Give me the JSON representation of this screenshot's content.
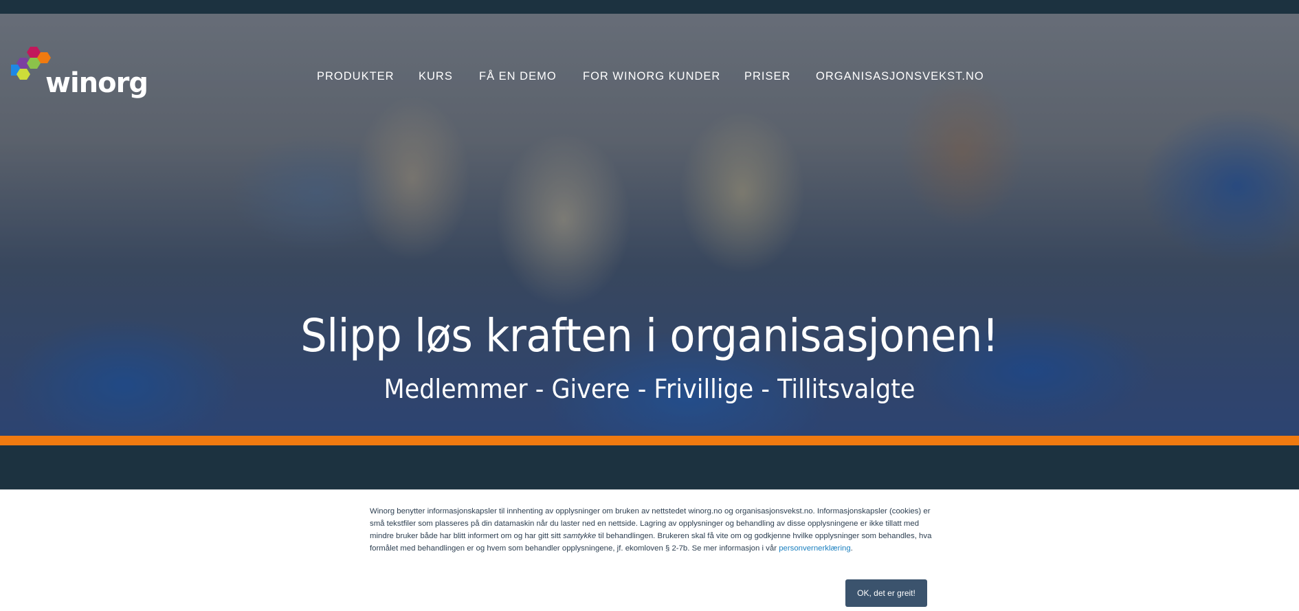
{
  "header": {
    "logo_text": "winorg",
    "nav": [
      {
        "label": "PRODUKTER"
      },
      {
        "label": "KURS"
      },
      {
        "label": "FÅ EN DEMO"
      },
      {
        "label": "FOR WINORG KUNDER"
      },
      {
        "label": "PRISER"
      },
      {
        "label": "ORGANISASJONSVEKST.NO"
      }
    ]
  },
  "hero": {
    "headline": "Slipp løs kraften i organisasjonen!",
    "subheadline": "Medlemmer - Givere - Frivillige - Tillitsvalgte"
  },
  "cookie_banner": {
    "text_part1": "Winorg benytter informasjonskapsler til innhenting av opplysninger om bruken av nettstedet winorg.no og organisasjonsvekst.no. Informasjonskapsler (cookies) er små tekstfiler som plasseres på din datamaskin når du laster ned en nettside. Lagring av opplysninger og behandling av disse opplysningene er ikke tillatt med mindre bruker både har blitt informert om og har gitt sitt ",
    "text_italic": "samtykke",
    "text_part2": " til behandlingen. Brukeren skal få vite om og godkjenne hvilke opplysninger som behandles, hva formålet med behandlingen er og hvem som behandler opplysningene, jf. ekomloven § 2-7b. Se mer informasjon i vår ",
    "link_text": "personvernerklæring",
    "text_end": ".",
    "ok_button": "OK, det er greit!"
  },
  "colors": {
    "dark": "#1c3240",
    "accent_orange": "#f07a10",
    "button": "#3b536d",
    "link": "#1a7fbf"
  }
}
